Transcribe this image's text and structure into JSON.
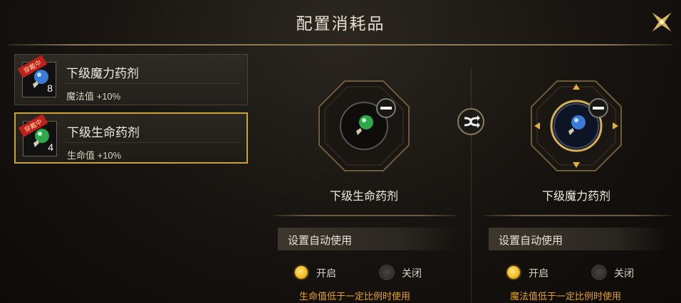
{
  "title": "配置消耗品",
  "items": [
    {
      "name": "下级魔力药剂",
      "desc": "魔法值 +10%",
      "count": "8",
      "badge": "穿戴中",
      "potion_color": "#3a7bd5"
    },
    {
      "name": "下级生命药剂",
      "desc": "生命值 +10%",
      "count": "4",
      "badge": "穿戴中",
      "potion_color": "#2ea84a"
    }
  ],
  "slots": [
    {
      "name": "下级生命药剂",
      "section": "设置自动使用",
      "on_label": "开启",
      "off_label": "关闭",
      "hint": "生命值低于一定比例时使用",
      "auto_use": true
    },
    {
      "name": "下级魔力药剂",
      "section": "设置自动使用",
      "on_label": "开启",
      "off_label": "关闭",
      "hint": "魔法值低于一定比例时使用",
      "auto_use": true
    }
  ],
  "colors": {
    "accent": "#c9a238",
    "hint": "#e8a020"
  },
  "icons": {
    "close": "close-icon",
    "swap": "swap-icon",
    "remove": "minus-icon"
  }
}
